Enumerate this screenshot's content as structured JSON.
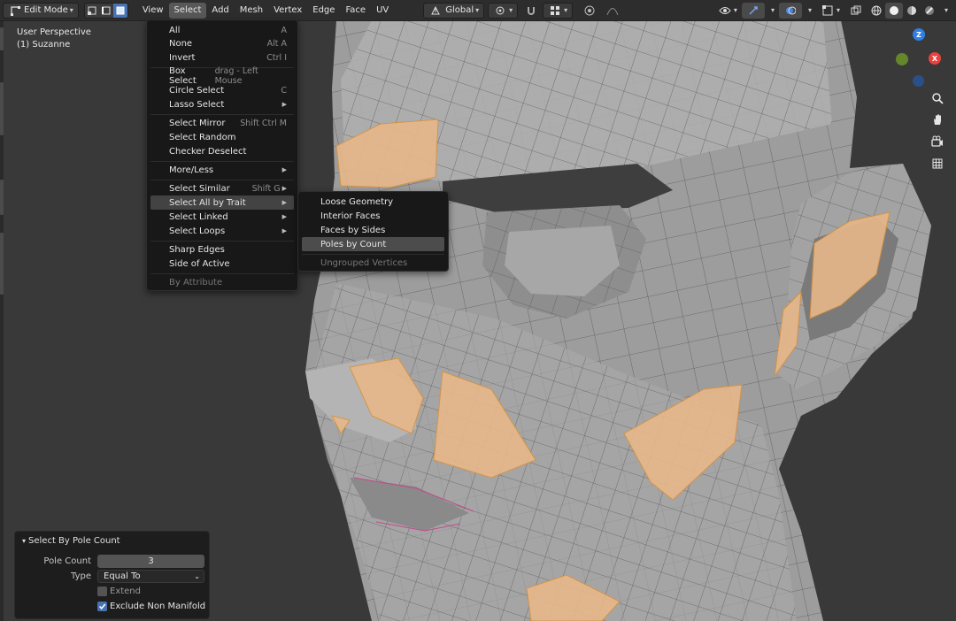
{
  "header": {
    "mode": "Edit Mode",
    "menus": [
      "View",
      "Select",
      "Add",
      "Mesh",
      "Vertex",
      "Edge",
      "Face",
      "UV"
    ],
    "active_menu": "Select",
    "transform_orientation": "Global"
  },
  "viewport": {
    "perspective_label": "User Perspective",
    "object_label": "(1) Suzanne",
    "gizmo": {
      "z": "Z",
      "x": "X"
    }
  },
  "select_menu": {
    "items": [
      {
        "label": "All",
        "shortcut": "A"
      },
      {
        "label": "None",
        "shortcut": "Alt A"
      },
      {
        "label": "Invert",
        "shortcut": "Ctrl I"
      },
      {
        "label": "Box Select",
        "shortcut": "drag - Left Mouse"
      },
      {
        "label": "Circle Select",
        "shortcut": "C"
      },
      {
        "label": "Lasso Select",
        "shortcut": ""
      },
      {
        "label": "Select Mirror",
        "shortcut": "Shift Ctrl M"
      },
      {
        "label": "Select Random",
        "shortcut": ""
      },
      {
        "label": "Checker Deselect",
        "shortcut": ""
      },
      {
        "label": "More/Less",
        "shortcut": ""
      },
      {
        "label": "Select Similar",
        "shortcut": "Shift G"
      },
      {
        "label": "Select All by Trait",
        "shortcut": ""
      },
      {
        "label": "Select Linked",
        "shortcut": ""
      },
      {
        "label": "Select Loops",
        "shortcut": ""
      },
      {
        "label": "Sharp Edges",
        "shortcut": ""
      },
      {
        "label": "Side of Active",
        "shortcut": ""
      },
      {
        "label": "By Attribute",
        "shortcut": ""
      }
    ]
  },
  "trait_submenu": {
    "items": [
      {
        "label": "Loose Geometry"
      },
      {
        "label": "Interior Faces"
      },
      {
        "label": "Faces by Sides"
      },
      {
        "label": "Poles by Count"
      },
      {
        "label": "Ungrouped Vertices"
      }
    ]
  },
  "operator_panel": {
    "title": "Select By Pole Count",
    "pole_count_label": "Pole Count",
    "pole_count_value": "3",
    "type_label": "Type",
    "type_value": "Equal To",
    "extend_label": "Extend",
    "extend_checked": false,
    "exclude_label": "Exclude Non Manifold",
    "exclude_checked": true
  },
  "colors": {
    "accent": "#4772b3",
    "menu_bg": "#181818",
    "header_bg": "#2d2d2d",
    "selection_face": "#e8b88a",
    "gizmo_x": "#e8423f",
    "gizmo_y": "#6a8f2a",
    "gizmo_z": "#2f7fe6"
  }
}
